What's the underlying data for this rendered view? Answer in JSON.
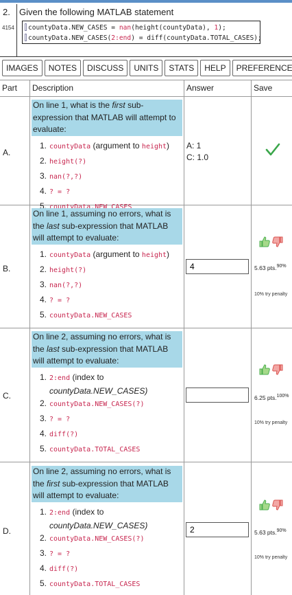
{
  "question": {
    "number": "2.",
    "id": "4154",
    "prompt": "Given the following MATLAB statement",
    "code_line1_a": "countyData.NEW_CASES = ",
    "code_line1_b": "nan",
    "code_line1_c": "(height(countyData), ",
    "code_line1_d": "1",
    "code_line1_e": ");",
    "code_line2_a": "countyData.NEW_CASES(",
    "code_line2_b": "2:end",
    "code_line2_c": ") = diff(countyData.TOTAL_CASES);"
  },
  "toolbar": [
    "IMAGES",
    "NOTES",
    "DISCUSS",
    "UNITS",
    "STATS",
    "HELP",
    "PREFERENCES"
  ],
  "table": {
    "headers": {
      "part": "Part",
      "description": "Description",
      "answer": "Answer",
      "save": "Save"
    }
  },
  "parts": {
    "a": {
      "label": "A.",
      "q_pre": "On line 1, what is the ",
      "q_em": "first",
      "q_post": " sub-expression that MATLAB will attempt to evaluate:",
      "o1_code": "countyData",
      "o1_mid": " (argument to ",
      "o1_code2": "height",
      "o1_end": ")",
      "o2": "height(?)",
      "o3": "nan(?,?)",
      "o4": "? = ?",
      "o5": "countyData.NEW_CASES",
      "answer_line1": "A: 1",
      "answer_line2": "C: 1.0"
    },
    "b": {
      "label": "B.",
      "q_pre": "On line 1, assuming no errors, what is the ",
      "q_em": "last",
      "q_post": " sub-expression that MATLAB will attempt to evaluate:",
      "o1_code": "countyData",
      "o1_mid": " (argument to ",
      "o1_code2": "height",
      "o1_end": ")",
      "o2": "height(?)",
      "o3": "nan(?,?)",
      "o4": "? = ?",
      "o5": "countyData.NEW_CASES",
      "answer": "4",
      "pts": "5.63 pts.",
      "pct": "90%",
      "penalty": "10% try penalty"
    },
    "c": {
      "label": "C.",
      "q_pre": "On line 2, assuming no errors, what is the ",
      "q_em": "last",
      "q_post": " sub-expression that MATLAB will attempt to evaluate:",
      "o1_code": "2:end",
      "o1_mid": " (index to",
      "o1_it": "countyData.NEW_CASES)",
      "o2": "countyData.NEW_CASES(?)",
      "o3": "? = ?",
      "o4": "diff(?)",
      "o5": "countyData.TOTAL_CASES",
      "answer": "",
      "pts": "6.25 pts.",
      "pct": "100%",
      "penalty": "10% try penalty"
    },
    "d": {
      "label": "D.",
      "q_pre": "On line 2, assuming no errors, what is the ",
      "q_em": "first",
      "q_post": " sub-expression that MATLAB will attempt to evaluate:",
      "o1_code": "2:end",
      "o1_mid": " (index to",
      "o1_it": "countyData.NEW_CASES)",
      "o2": "countyData.NEW_CASES(?)",
      "o3": "? = ?",
      "o4": "diff(?)",
      "o5": "countyData.TOTAL_CASES",
      "answer": "2",
      "pts": "5.63 pts.",
      "pct": "90%",
      "penalty": "10% try penalty"
    }
  },
  "nums": [
    "1.",
    "2.",
    "3.",
    "4.",
    "5."
  ],
  "colors": {
    "highlight": "#a8d8e8",
    "code": "#c7254e",
    "check": "#3aa64a",
    "thumb_up": "#4caf50",
    "thumb_down": "#d9534f"
  }
}
